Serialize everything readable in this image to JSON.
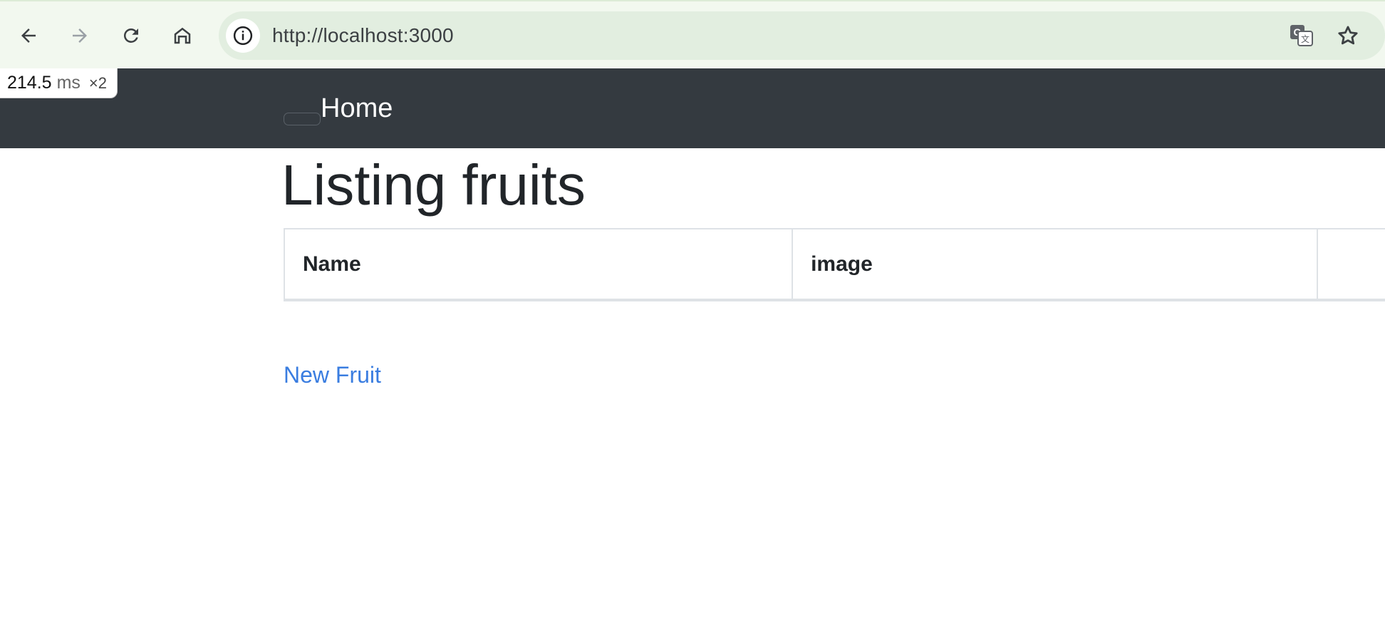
{
  "browser": {
    "url": "http://localhost:3000"
  },
  "perf": {
    "value": "214.5",
    "unit": "ms",
    "multiplier": "×2"
  },
  "navbar": {
    "brand": "Home"
  },
  "page": {
    "title": "Listing fruits"
  },
  "table": {
    "headers": [
      "Name",
      "image",
      ""
    ]
  },
  "actions": {
    "new_link": "New Fruit"
  },
  "colors": {
    "navbar_bg": "#343a40",
    "link": "#3a7de0",
    "toolbar_bg": "#f2f8ef",
    "omnibox_bg": "#e2eee0"
  }
}
